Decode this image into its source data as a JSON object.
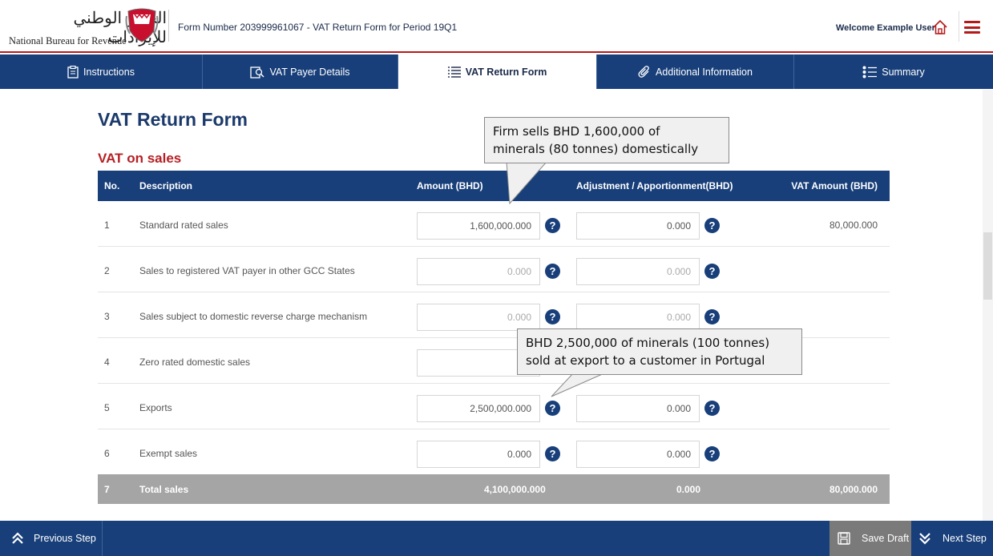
{
  "header": {
    "logo_arabic": "الجهاز الوطني للإيرادات",
    "logo_english": "National Bureau for Revenue",
    "form_title": "Form Number 203999961067 - VAT Return Form for Period 19Q1",
    "welcome": "Welcome Example User"
  },
  "tabs": [
    {
      "label": "Instructions",
      "icon": "clipboard-icon"
    },
    {
      "label": "VAT Payer Details",
      "icon": "user-search-icon"
    },
    {
      "label": "VAT Return Form",
      "icon": "list-icon",
      "active": true
    },
    {
      "label": "Additional Information",
      "icon": "paperclip-icon"
    },
    {
      "label": "Summary",
      "icon": "bullet-list-icon"
    }
  ],
  "main": {
    "page_title": "VAT Return Form",
    "section_title": "VAT on sales"
  },
  "table": {
    "headers": {
      "no": "No.",
      "description": "Description",
      "amount": "Amount (BHD)",
      "adjustment": "Adjustment / Apportionment(BHD)",
      "vat_amount": "VAT Amount (BHD)"
    },
    "rows": [
      {
        "no": "1",
        "description": "Standard rated sales",
        "amount": "1,600,000.000",
        "adjustment": "0.000",
        "vat": "80,000.000"
      },
      {
        "no": "2",
        "description": "Sales to registered VAT payer in other GCC States",
        "amount": "0.000",
        "adjustment": "0.000",
        "vat": ""
      },
      {
        "no": "3",
        "description": "Sales subject to domestic reverse charge mechanism",
        "amount": "0.000",
        "adjustment": "0.000",
        "vat": ""
      },
      {
        "no": "4",
        "description": "Zero rated domestic sales",
        "amount": "0",
        "adjustment": "",
        "vat": ""
      },
      {
        "no": "5",
        "description": "Exports",
        "amount": "2,500,000.000",
        "adjustment": "0.000",
        "vat": ""
      },
      {
        "no": "6",
        "description": "Exempt sales",
        "amount": "0.000",
        "adjustment": "0.000",
        "vat": ""
      }
    ],
    "total": {
      "no": "7",
      "description": "Total sales",
      "amount": "4,100,000.000",
      "adjustment": "0.000",
      "vat": "80,000.000"
    }
  },
  "callouts": {
    "first_line1": "Firm sells BHD 1,600,000  of",
    "first_line2": "minerals (80 tonnes) domestically",
    "second_line1": "BHD 2,500,000 of minerals (100 tonnes)",
    "second_line2": "sold at export to a customer in Portugal"
  },
  "footer": {
    "previous": "Previous Step",
    "save": "Save Draft",
    "next": "Next Step"
  },
  "colors": {
    "navy": "#183f7a",
    "red": "#b52025",
    "total_gray": "#a5a5a5"
  }
}
